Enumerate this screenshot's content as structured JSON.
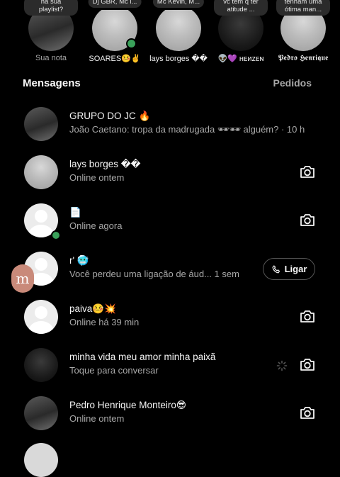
{
  "notes": [
    {
      "bubble": "na sua playlist?",
      "name": "Sua nota",
      "muted": true
    },
    {
      "bubble": "Dj GBR, Mc l...",
      "name": "SOARES🤒✌️",
      "muted": false,
      "online": true
    },
    {
      "bubble": "Mc Kevin, M...",
      "name": "lays borges ��",
      "muted": false
    },
    {
      "bubble": "vc tem q ter atitude ...",
      "name": "👽💜 ʜᴇᴎᴢᴇɴ",
      "muted": false
    },
    {
      "bubble": "tenham uma ótima man...",
      "name": "𝕻𝖊𝖉𝖗𝖔 𝕳𝖊𝖓𝖗𝖎𝖖𝖚𝖊",
      "muted": false
    }
  ],
  "section": {
    "title": "Mensagens",
    "requests": "Pedidos"
  },
  "conversations": [
    {
      "title": "GRUPO DO JC 🔥",
      "sub": "João Caetano: tropa da madrugada 🕶🕶 alguém? · 10 h",
      "avatar": "photo",
      "action": "none"
    },
    {
      "title": "lays borges ��",
      "sub": "Online ontem",
      "avatar": "grey",
      "action": "camera"
    },
    {
      "title": "📄",
      "sub": "Online agora",
      "avatar": "white",
      "online": true,
      "action": "camera"
    },
    {
      "title": "r' 🥶",
      "sub": "Você perdeu uma ligação de áud...   1 sem",
      "avatar": "white",
      "action": "call"
    },
    {
      "title": "paiva🤒💥",
      "sub": "Online há 39 min",
      "avatar": "white",
      "action": "camera"
    },
    {
      "title": "minha vida meu amor minha paixã",
      "sub": "Toque para conversar",
      "avatar": "dark",
      "action": "camera-loading"
    },
    {
      "title": "Pedro Henrique Monteiro😎",
      "sub": "Online ontem",
      "avatar": "photo",
      "action": "camera"
    }
  ],
  "call_label": "Ligar",
  "icons": {
    "camera": "camera-icon",
    "phone": "phone-icon"
  },
  "colors": {
    "background": "#000000",
    "online": "#3aa15a",
    "muted_text": "#a8a8a8"
  }
}
